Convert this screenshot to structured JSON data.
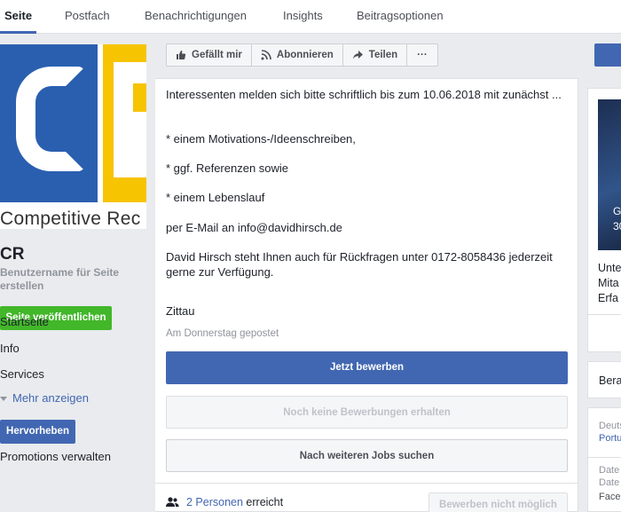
{
  "nav": {
    "tabs": [
      "Seite",
      "Postfach",
      "Benachrichtigungen",
      "Insights",
      "Beitragsoptionen"
    ],
    "active_index": 0
  },
  "sidebar": {
    "logo_text": "Competitive Rec",
    "page_name": "CR",
    "username_link": "Benutzername für Seite erstellen",
    "publish_label": "Seite veröffentlichen",
    "items": [
      "Startseite",
      "Info",
      "Services"
    ],
    "more_label": "Mehr anzeigen",
    "boost_label": "Hervorheben",
    "promotions_label": "Promotions verwalten"
  },
  "actions": {
    "like": "Gefällt mir",
    "subscribe": "Abonnieren",
    "share": "Teilen",
    "more": "···"
  },
  "post": {
    "lines": [
      "Interessenten melden sich bitte schriftlich bis zum 10.06.2018 mit zunächst ...",
      "* einem Motivations-/Ideenschreiben,",
      "* ggf. Referenzen sowie",
      "* einem Lebenslauf",
      "per E-Mail an info@davidhirsch.de",
      "David Hirsch steht Ihnen auch für Rückfragen unter 0172-8058436 jederzeit gerne zur Verfügung.",
      "Zittau"
    ],
    "posted": "Am Donnerstag gepostet",
    "apply_label": "Jetzt bewerben",
    "no_applications_label": "Noch keine Bewerbungen erhalten",
    "more_jobs_label": "Nach weiteren Jobs suchen",
    "reach_count": "2 Personen",
    "reach_suffix": "erreicht",
    "apply_disabled_label": "Bewerben nicht möglich"
  },
  "right": {
    "img_text_1": "G",
    "img_text_2": "30",
    "text_1": "Unte",
    "text_2": "Mita",
    "text_3": "Erfa",
    "card3_text": "Bera",
    "lang_1": "Deuts",
    "lang_2": "Portu",
    "footer_1": "Date",
    "footer_2": "Date",
    "footer_3": "Face"
  },
  "colors": {
    "brand_blue": "#4267b2",
    "publish_green": "#42b72a",
    "logo_blue": "#2a5fb0",
    "logo_yellow": "#f6c400"
  }
}
